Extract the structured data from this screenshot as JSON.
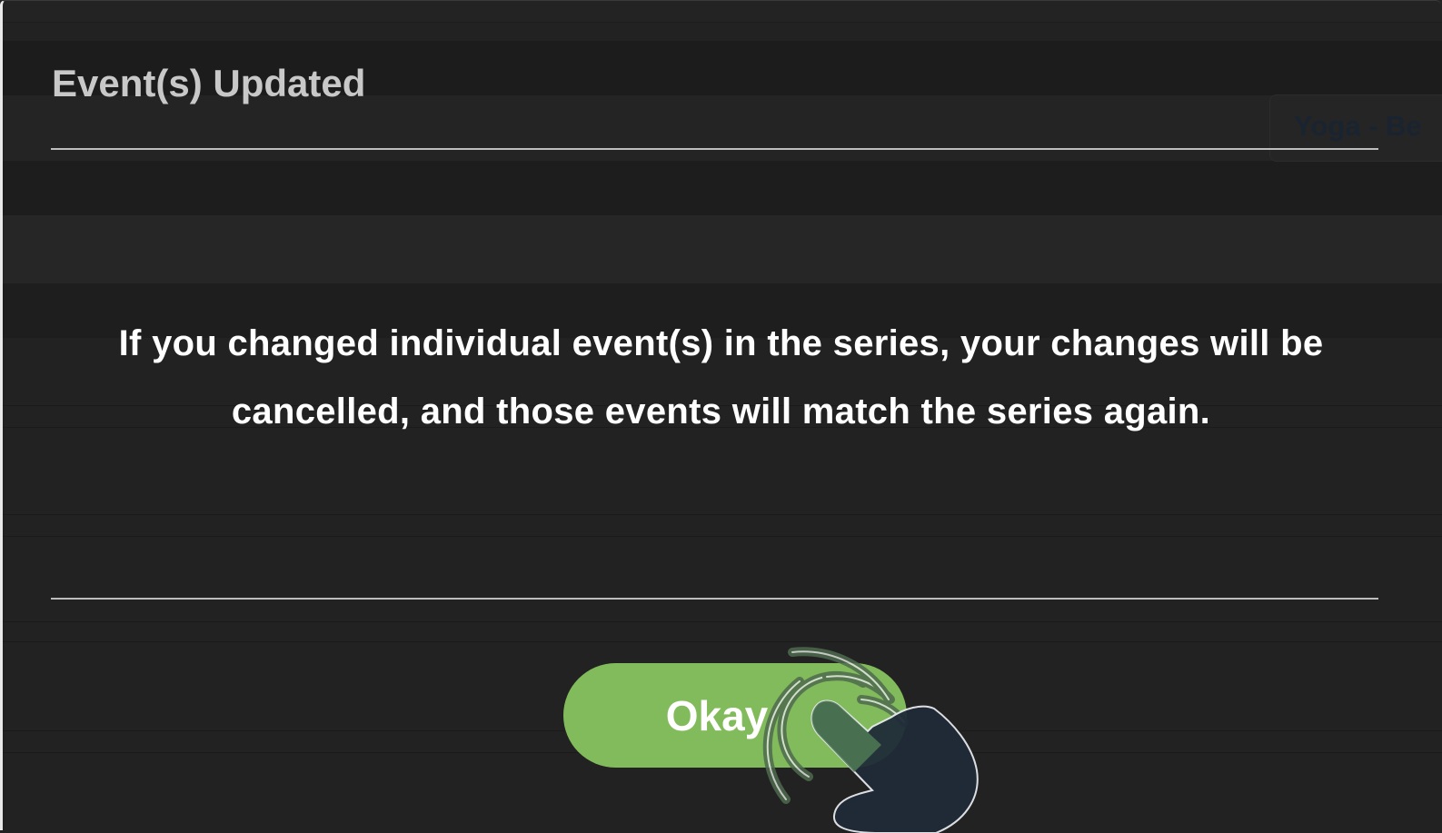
{
  "dialog": {
    "title": "Event(s) Updated",
    "message": "If you changed individual event(s) in the series, your changes will be cancelled, and those events will match the series again.",
    "confirm_label": "Okay"
  },
  "background": {
    "event_chip_label": "Yoga - Be"
  },
  "colors": {
    "overlay": "#222222",
    "button": "#82bb5b",
    "title_text": "#c8c8c8",
    "message_text": "#ffffff",
    "hand_icon": "#202b38"
  },
  "icons": {
    "tap_hint": "tap-hand-icon"
  }
}
